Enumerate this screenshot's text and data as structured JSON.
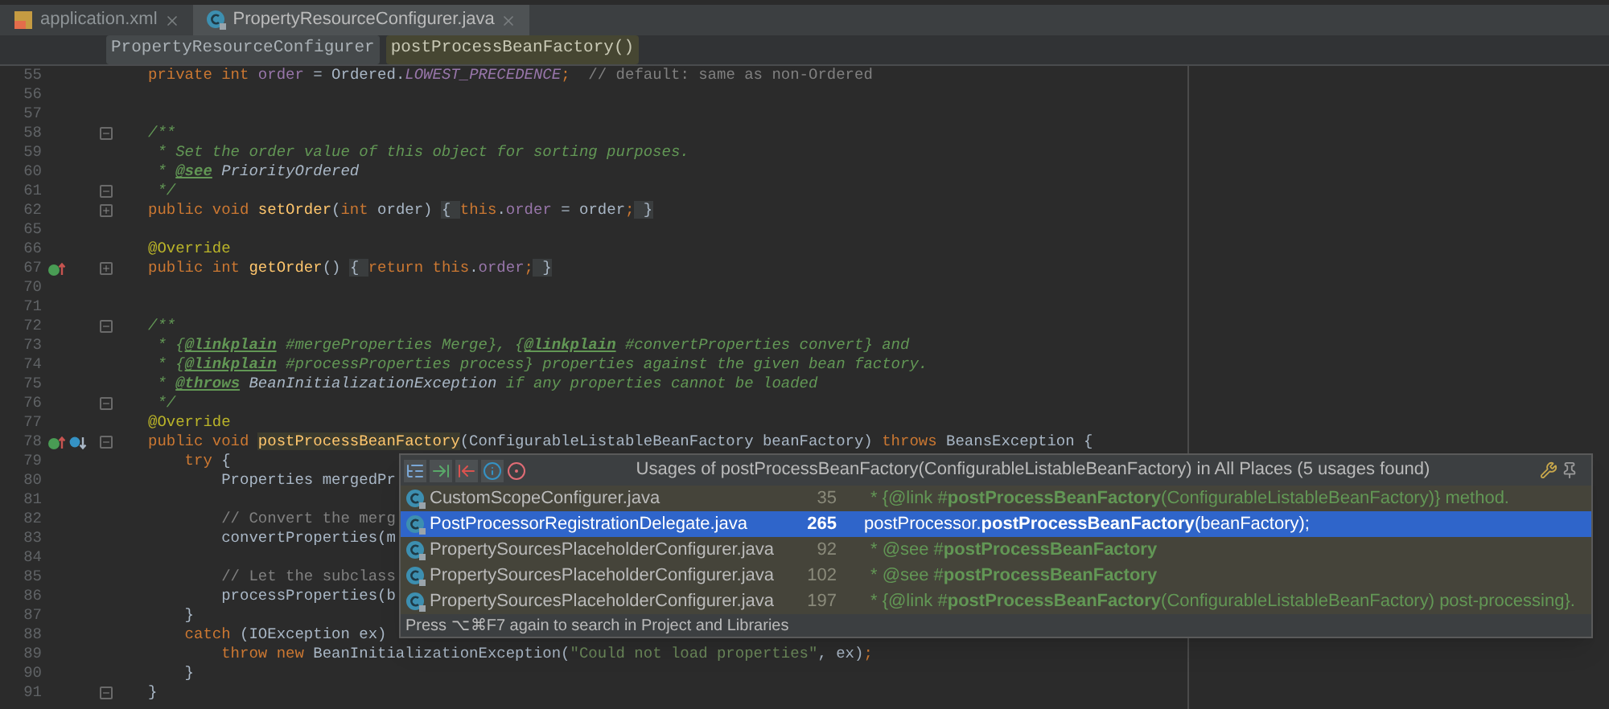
{
  "tabs": [
    {
      "label": "application.xml",
      "kind": "xml",
      "selected": false
    },
    {
      "label": "PropertyResourceConfigurer.java",
      "kind": "class",
      "selected": true
    }
  ],
  "breadcrumbs": [
    {
      "label": "PropertyResourceConfigurer",
      "selected": false
    },
    {
      "label": "postProcessBeanFactory()",
      "selected": true
    }
  ],
  "lines": [
    {
      "number": "55",
      "segments": [
        {
          "kind": "kw",
          "text": "private int "
        },
        {
          "kind": "field",
          "text": "order"
        },
        {
          "kind": "plain",
          "text": " = Ordered."
        },
        {
          "kind": "static",
          "text": "LOWEST_PRECEDENCE"
        },
        {
          "kind": "kw",
          "text": ";"
        },
        {
          "kind": "comment",
          "text": "  // default: same as non-Ordered"
        }
      ]
    },
    {
      "number": "56"
    },
    {
      "number": "57"
    },
    {
      "number": "58",
      "markers": [
        {
          "kind": "fold_start"
        }
      ],
      "segments": [
        {
          "kind": "doc",
          "text": "/**"
        }
      ]
    },
    {
      "number": "59",
      "segments": [
        {
          "kind": "doc",
          "text": " * Set the order value of this object for sorting purposes."
        }
      ]
    },
    {
      "number": "60",
      "segments": [
        {
          "kind": "doc",
          "text": " * "
        },
        {
          "kind": "doctag",
          "text": "@see"
        },
        {
          "kind": "docref",
          "text": " PriorityOrdered"
        }
      ]
    },
    {
      "number": "61",
      "markers": [
        {
          "kind": "fold_end"
        }
      ],
      "segments": [
        {
          "kind": "doc",
          "text": " */"
        }
      ]
    },
    {
      "number": "62",
      "markers": [
        {
          "kind": "fold_collapsed"
        }
      ],
      "segments": [
        {
          "kind": "kw",
          "text": "public void "
        },
        {
          "kind": "method",
          "text": "setOrder"
        },
        {
          "kind": "plain",
          "text": "("
        },
        {
          "kind": "kw",
          "text": "int "
        },
        {
          "kind": "plain",
          "text": "order) "
        },
        {
          "kind": "folded",
          "text": "{ "
        },
        {
          "kind": "kw",
          "text": "this"
        },
        {
          "kind": "plain",
          "text": "."
        },
        {
          "kind": "field",
          "text": "order"
        },
        {
          "kind": "plain",
          "text": " = order"
        },
        {
          "kind": "kw",
          "text": ";"
        },
        {
          "kind": "folded",
          "text": " }"
        }
      ]
    },
    {
      "number": "65"
    },
    {
      "number": "66",
      "segments": [
        {
          "kind": "annot",
          "text": "@Override"
        }
      ]
    },
    {
      "number": "67",
      "markers": [
        {
          "kind": "overrides"
        },
        {
          "kind": "fold_collapsed"
        }
      ],
      "segments": [
        {
          "kind": "kw",
          "text": "public int "
        },
        {
          "kind": "method",
          "text": "getOrder"
        },
        {
          "kind": "plain",
          "text": "() "
        },
        {
          "kind": "folded",
          "text": "{ "
        },
        {
          "kind": "kw",
          "text": "return this"
        },
        {
          "kind": "plain",
          "text": "."
        },
        {
          "kind": "field",
          "text": "order"
        },
        {
          "kind": "kw",
          "text": ";"
        },
        {
          "kind": "folded",
          "text": " }"
        }
      ]
    },
    {
      "number": "70"
    },
    {
      "number": "71"
    },
    {
      "number": "72",
      "markers": [
        {
          "kind": "fold_start"
        }
      ],
      "segments": [
        {
          "kind": "doc",
          "text": "/**"
        }
      ]
    },
    {
      "number": "73",
      "segments": [
        {
          "kind": "doc",
          "text": " * {"
        },
        {
          "kind": "doctag",
          "text": "@linkplain"
        },
        {
          "kind": "doc",
          "text": " #mergeProperties Merge}, {"
        },
        {
          "kind": "doctag",
          "text": "@linkplain"
        },
        {
          "kind": "doc",
          "text": " #convertProperties convert} and"
        }
      ]
    },
    {
      "number": "74",
      "segments": [
        {
          "kind": "doc",
          "text": " * {"
        },
        {
          "kind": "doctag",
          "text": "@linkplain"
        },
        {
          "kind": "doc",
          "text": " #processProperties process} properties against the given bean factory."
        }
      ]
    },
    {
      "number": "75",
      "segments": [
        {
          "kind": "doc",
          "text": " * "
        },
        {
          "kind": "doctag",
          "text": "@throws"
        },
        {
          "kind": "docref",
          "text": " BeanInitializationException"
        },
        {
          "kind": "doc",
          "text": " if any properties cannot be loaded"
        }
      ]
    },
    {
      "number": "76",
      "markers": [
        {
          "kind": "fold_end"
        }
      ],
      "segments": [
        {
          "kind": "doc",
          "text": " */"
        }
      ]
    },
    {
      "number": "77",
      "segments": [
        {
          "kind": "annot",
          "text": "@Override"
        }
      ]
    },
    {
      "number": "78",
      "markers": [
        {
          "kind": "overrides"
        },
        {
          "kind": "overridden"
        },
        {
          "kind": "fold_start"
        }
      ],
      "segments": [
        {
          "kind": "kw",
          "text": "public void "
        },
        {
          "kind": "usage",
          "text": "postProcessBeanFactory"
        },
        {
          "kind": "plain",
          "text": "(ConfigurableListableBeanFactory beanFactory) "
        },
        {
          "kind": "kw",
          "text": "throws "
        },
        {
          "kind": "plain",
          "text": "BeansException {"
        }
      ]
    },
    {
      "number": "79",
      "segments": [
        {
          "kind": "kw",
          "text": "    try "
        },
        {
          "kind": "plain",
          "text": "{"
        }
      ]
    },
    {
      "number": "80",
      "segments": [
        {
          "kind": "plain",
          "text": "        Properties mergedPr"
        }
      ]
    },
    {
      "number": "81"
    },
    {
      "number": "82",
      "segments": [
        {
          "kind": "comment",
          "text": "        // Convert the merg"
        }
      ]
    },
    {
      "number": "83",
      "segments": [
        {
          "kind": "plain",
          "text": "        convertProperties(m"
        }
      ]
    },
    {
      "number": "84"
    },
    {
      "number": "85",
      "segments": [
        {
          "kind": "comment",
          "text": "        // Let the subclass"
        }
      ]
    },
    {
      "number": "86",
      "segments": [
        {
          "kind": "plain",
          "text": "        processProperties(b"
        }
      ]
    },
    {
      "number": "87",
      "segments": [
        {
          "kind": "plain",
          "text": "    }"
        }
      ]
    },
    {
      "number": "88",
      "segments": [
        {
          "kind": "kw",
          "text": "    catch "
        },
        {
          "kind": "plain",
          "text": "(IOException ex)"
        }
      ]
    },
    {
      "number": "89",
      "segments": [
        {
          "kind": "kw",
          "text": "        throw new "
        },
        {
          "kind": "plain",
          "text": "BeanInitializationException("
        },
        {
          "kind": "string",
          "text": "\"Could not load properties\""
        },
        {
          "kind": "plain",
          "text": ", ex)"
        },
        {
          "kind": "kw",
          "text": ";"
        }
      ]
    },
    {
      "number": "90",
      "segments": [
        {
          "kind": "plain",
          "text": "    }"
        }
      ]
    },
    {
      "number": "91",
      "markers": [
        {
          "kind": "fold_end"
        }
      ],
      "segments": [
        {
          "kind": "plain",
          "text": "}"
        }
      ]
    }
  ],
  "usages_popup": {
    "title": "Usages of postProcessBeanFactory(ConfigurableListableBeanFactory) in All Places (5 usages found)",
    "rows": [
      {
        "file": "CustomScopeConfigurer.java",
        "line": "35",
        "kind": "comment",
        "snippet": "* {@link #**postProcessBeanFactory**(ConfigurableListableBeanFactory)} method.",
        "selected": false
      },
      {
        "file": "PostProcessorRegistrationDelegate.java",
        "line": "265",
        "kind": "code",
        "snippet": "postProcessor.**postProcessBeanFactory**(beanFactory);",
        "selected": true
      },
      {
        "file": "PropertySourcesPlaceholderConfigurer.java",
        "line": "92",
        "kind": "comment",
        "snippet": "* @see #**postProcessBeanFactory**",
        "selected": false
      },
      {
        "file": "PropertySourcesPlaceholderConfigurer.java",
        "line": "102",
        "kind": "comment",
        "snippet": "* @see #**postProcessBeanFactory**",
        "selected": false
      },
      {
        "file": "PropertySourcesPlaceholderConfigurer.java",
        "line": "197",
        "kind": "comment",
        "snippet": "* {@link #**postProcessBeanFactory**(ConfigurableListableBeanFactory) post-processing}.",
        "selected": false
      }
    ],
    "footer": "Press ⌥⌘F7 again to search in Project and Libraries"
  }
}
